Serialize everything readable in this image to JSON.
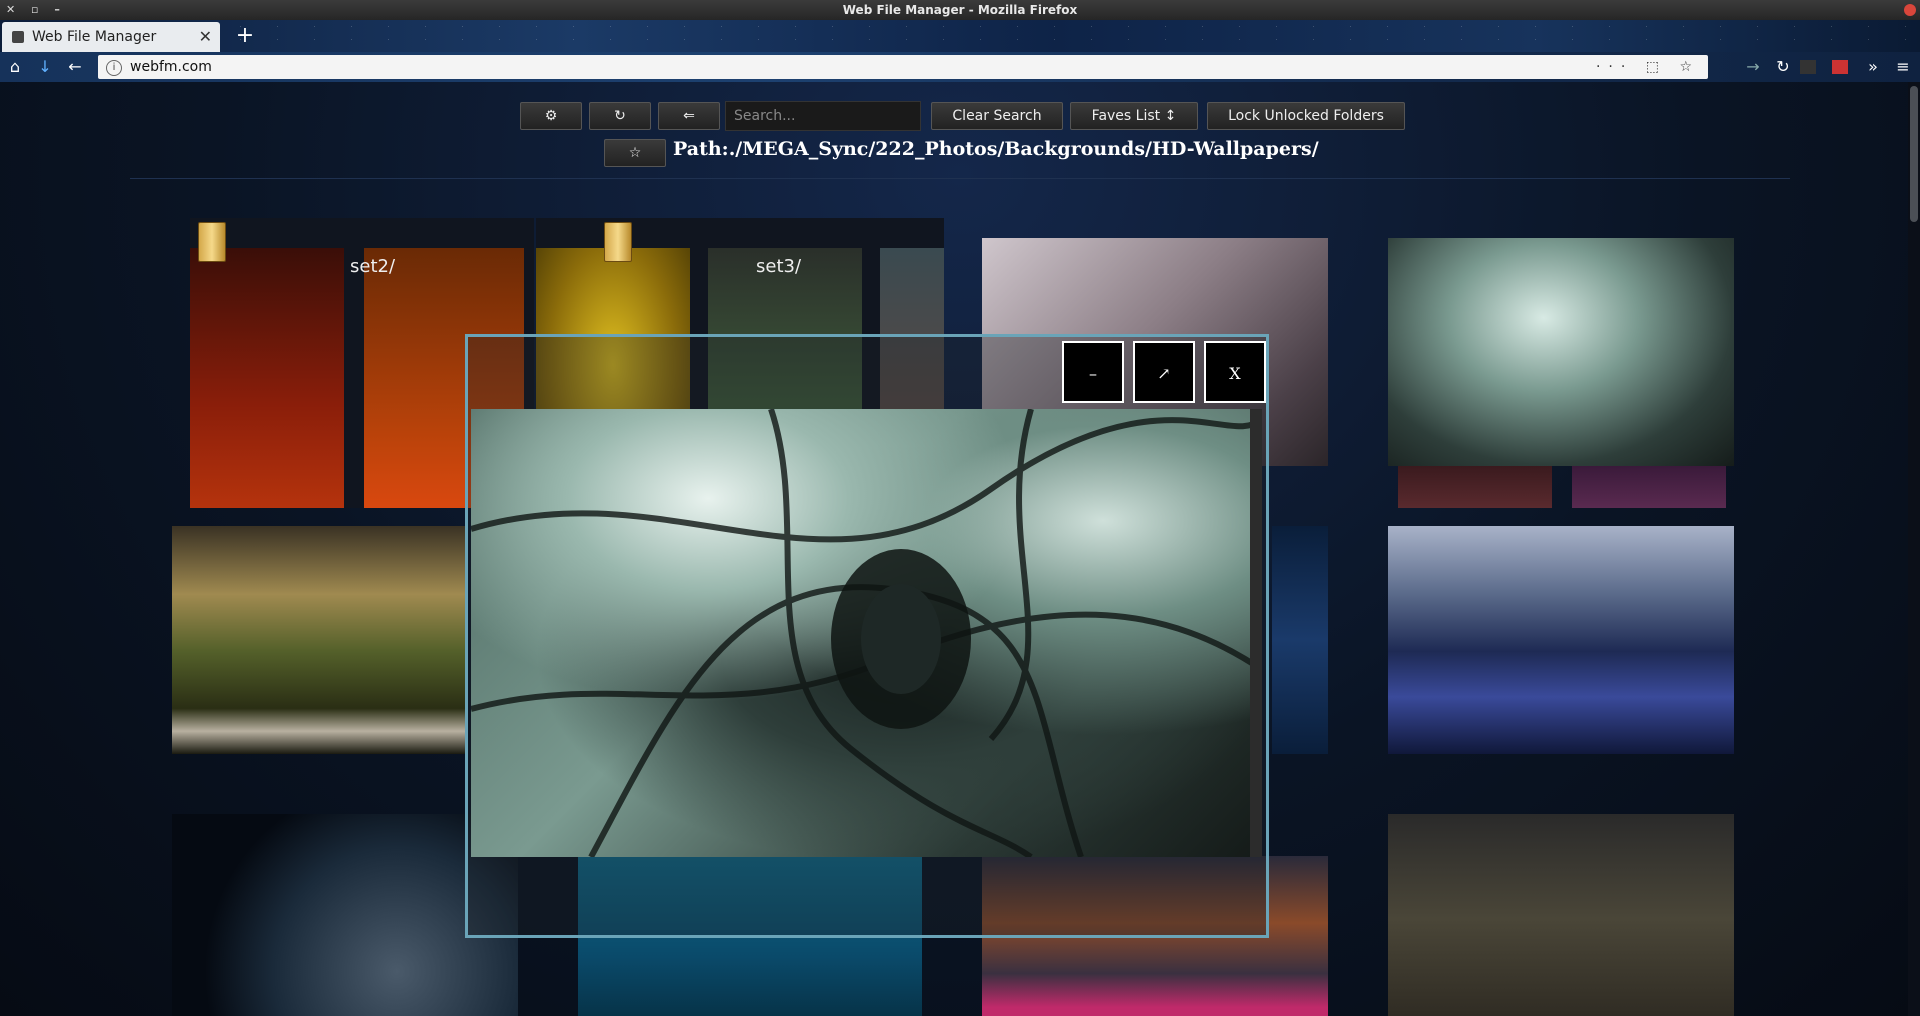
{
  "window": {
    "title": "Web File Manager - Mozilla Firefox",
    "wm_buttons": "✕ ▫ –"
  },
  "browser": {
    "tab_title": "Web File Manager",
    "tab_close": "✕",
    "new_tab": "+",
    "url": "webfm.com",
    "url_actions": "··· ⬚ ☆",
    "nav_icons": {
      "home": "⌂",
      "download": "↓",
      "back": "←",
      "forward": "→",
      "reload": "↻",
      "overflow": "»",
      "menu": "≡"
    }
  },
  "toolbar": {
    "settings_label": "⚙",
    "refresh_label": "↻",
    "back_label": "⇐",
    "search_placeholder": "Search...",
    "clear_search_label": "Clear Search",
    "faves_list_label": "Faves List ↕",
    "lock_label": "Lock Unlocked Folders",
    "fave_star_label": "☆"
  },
  "path": "Path:./MEGA_Sync/222_Photos/Backgrounds/HD-Wallpapers/",
  "folders": [
    {
      "name": "set2/"
    },
    {
      "name": "set3/"
    }
  ],
  "modal": {
    "minimize_label": "–",
    "maximize_label": "↗",
    "close_label": "X"
  },
  "colors": {
    "modal_border": "#6aa4b8",
    "page_bg": "#0a1424"
  }
}
